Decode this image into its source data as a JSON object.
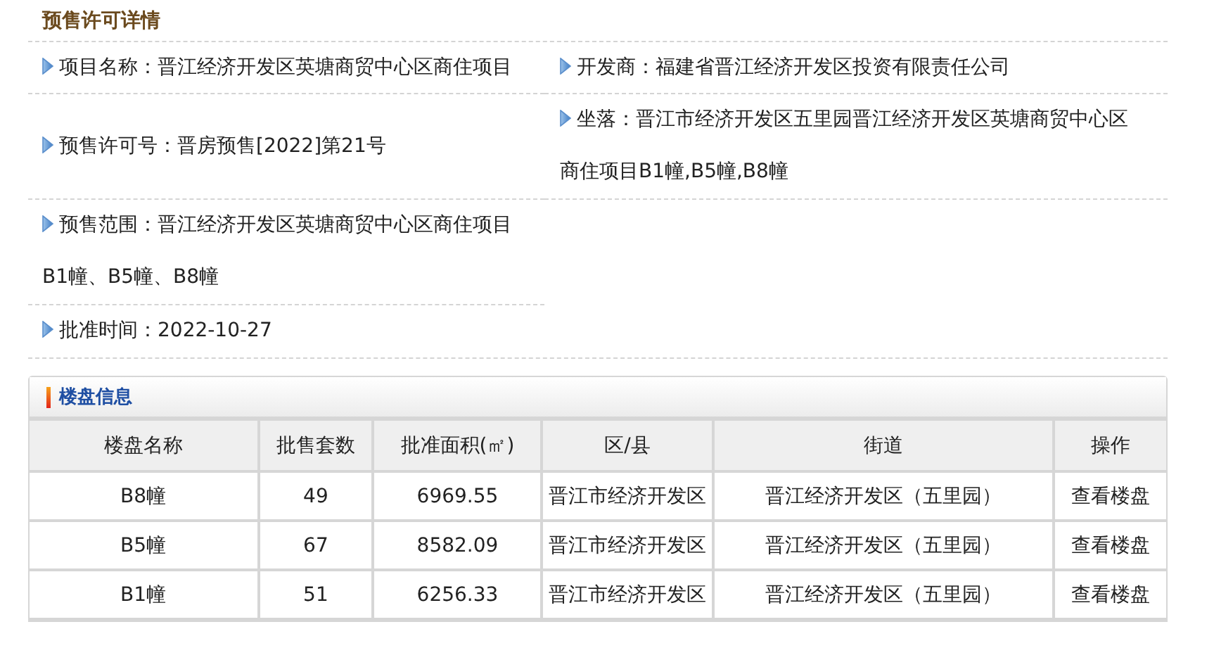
{
  "title": "预售许可详情",
  "details_left": [
    {
      "text": "项目名称：晋江经济开发区英塘商贸中心区商住项目"
    },
    {
      "text": "预售许可号：晋房预售[2022]第21号"
    },
    {
      "text": "预售范围：晋江经济开发区英塘商贸中心区商住项目B1幢、B5幢、B8幢"
    },
    {
      "text": "批准时间：2022-10-27"
    }
  ],
  "details_right": [
    {
      "text": "开发商：福建省晋江经济开发区投资有限责任公司"
    },
    {
      "text": "坐落：晋江市经济开发区五里园晋江经济开发区英塘商贸中心区商住项目B1幢,B5幢,B8幢"
    }
  ],
  "buildings": {
    "title": "楼盘信息",
    "columns": [
      "楼盘名称",
      "批售套数",
      "批准面积(㎡)",
      "区/县",
      "街道",
      "操作"
    ],
    "rows": [
      [
        "B8幢",
        "49",
        "6969.55",
        "晋江市经济开发区",
        "晋江经济开发区（五里园）",
        "查看楼盘"
      ],
      [
        "B5幢",
        "67",
        "8582.09",
        "晋江市经济开发区",
        "晋江经济开发区（五里园）",
        "查看楼盘"
      ],
      [
        "B1幢",
        "51",
        "6256.33",
        "晋江市经济开发区",
        "晋江经济开发区（五里园）",
        "查看楼盘"
      ]
    ]
  }
}
